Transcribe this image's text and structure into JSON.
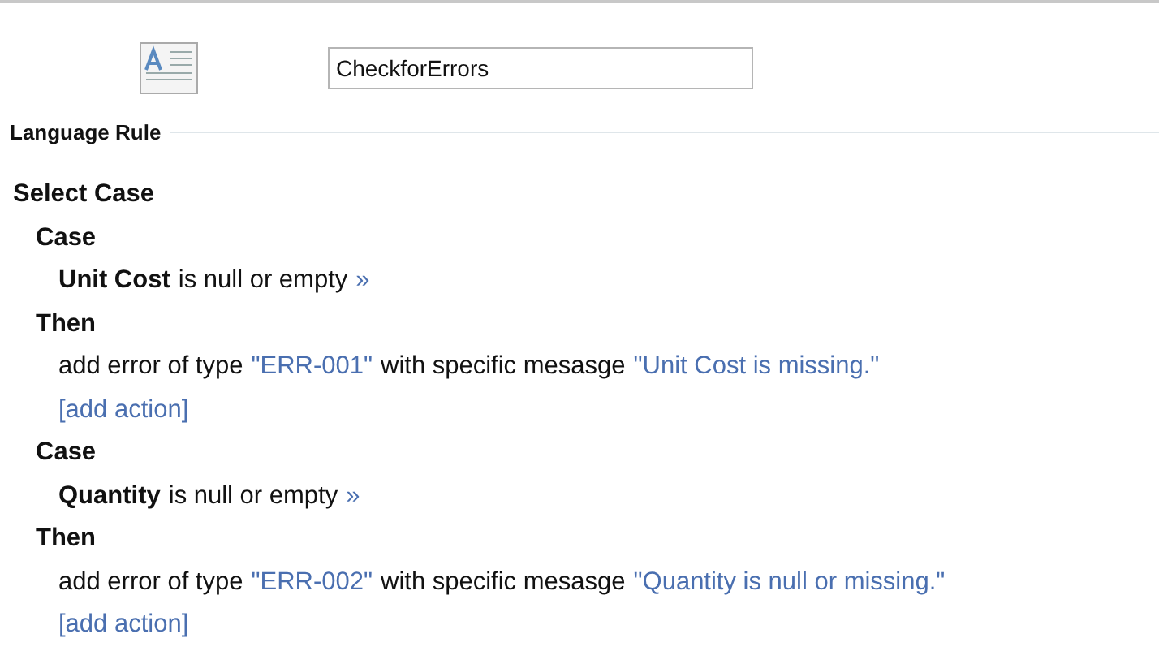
{
  "rule_name": {
    "value": "CheckforErrors"
  },
  "section_title": "Language Rule",
  "select_case": {
    "label": "Select Case",
    "cases": [
      {
        "case_label": "Case",
        "field": "Unit Cost",
        "condition": "is null or empty",
        "more": "»",
        "then_label": "Then",
        "action": [
          "add error of type",
          "\"ERR-001\"",
          "with specific mesasge",
          "\"Unit Cost is missing.\""
        ],
        "add_action": "[add action]"
      },
      {
        "case_label": "Case",
        "field": "Quantity",
        "condition": "is null or empty",
        "more": "»",
        "then_label": "Then",
        "action": [
          "add error of type",
          "\"ERR-002\"",
          "with specific mesasge",
          "\"Quantity is null or missing.\""
        ],
        "add_action": "[add action]"
      }
    ]
  }
}
